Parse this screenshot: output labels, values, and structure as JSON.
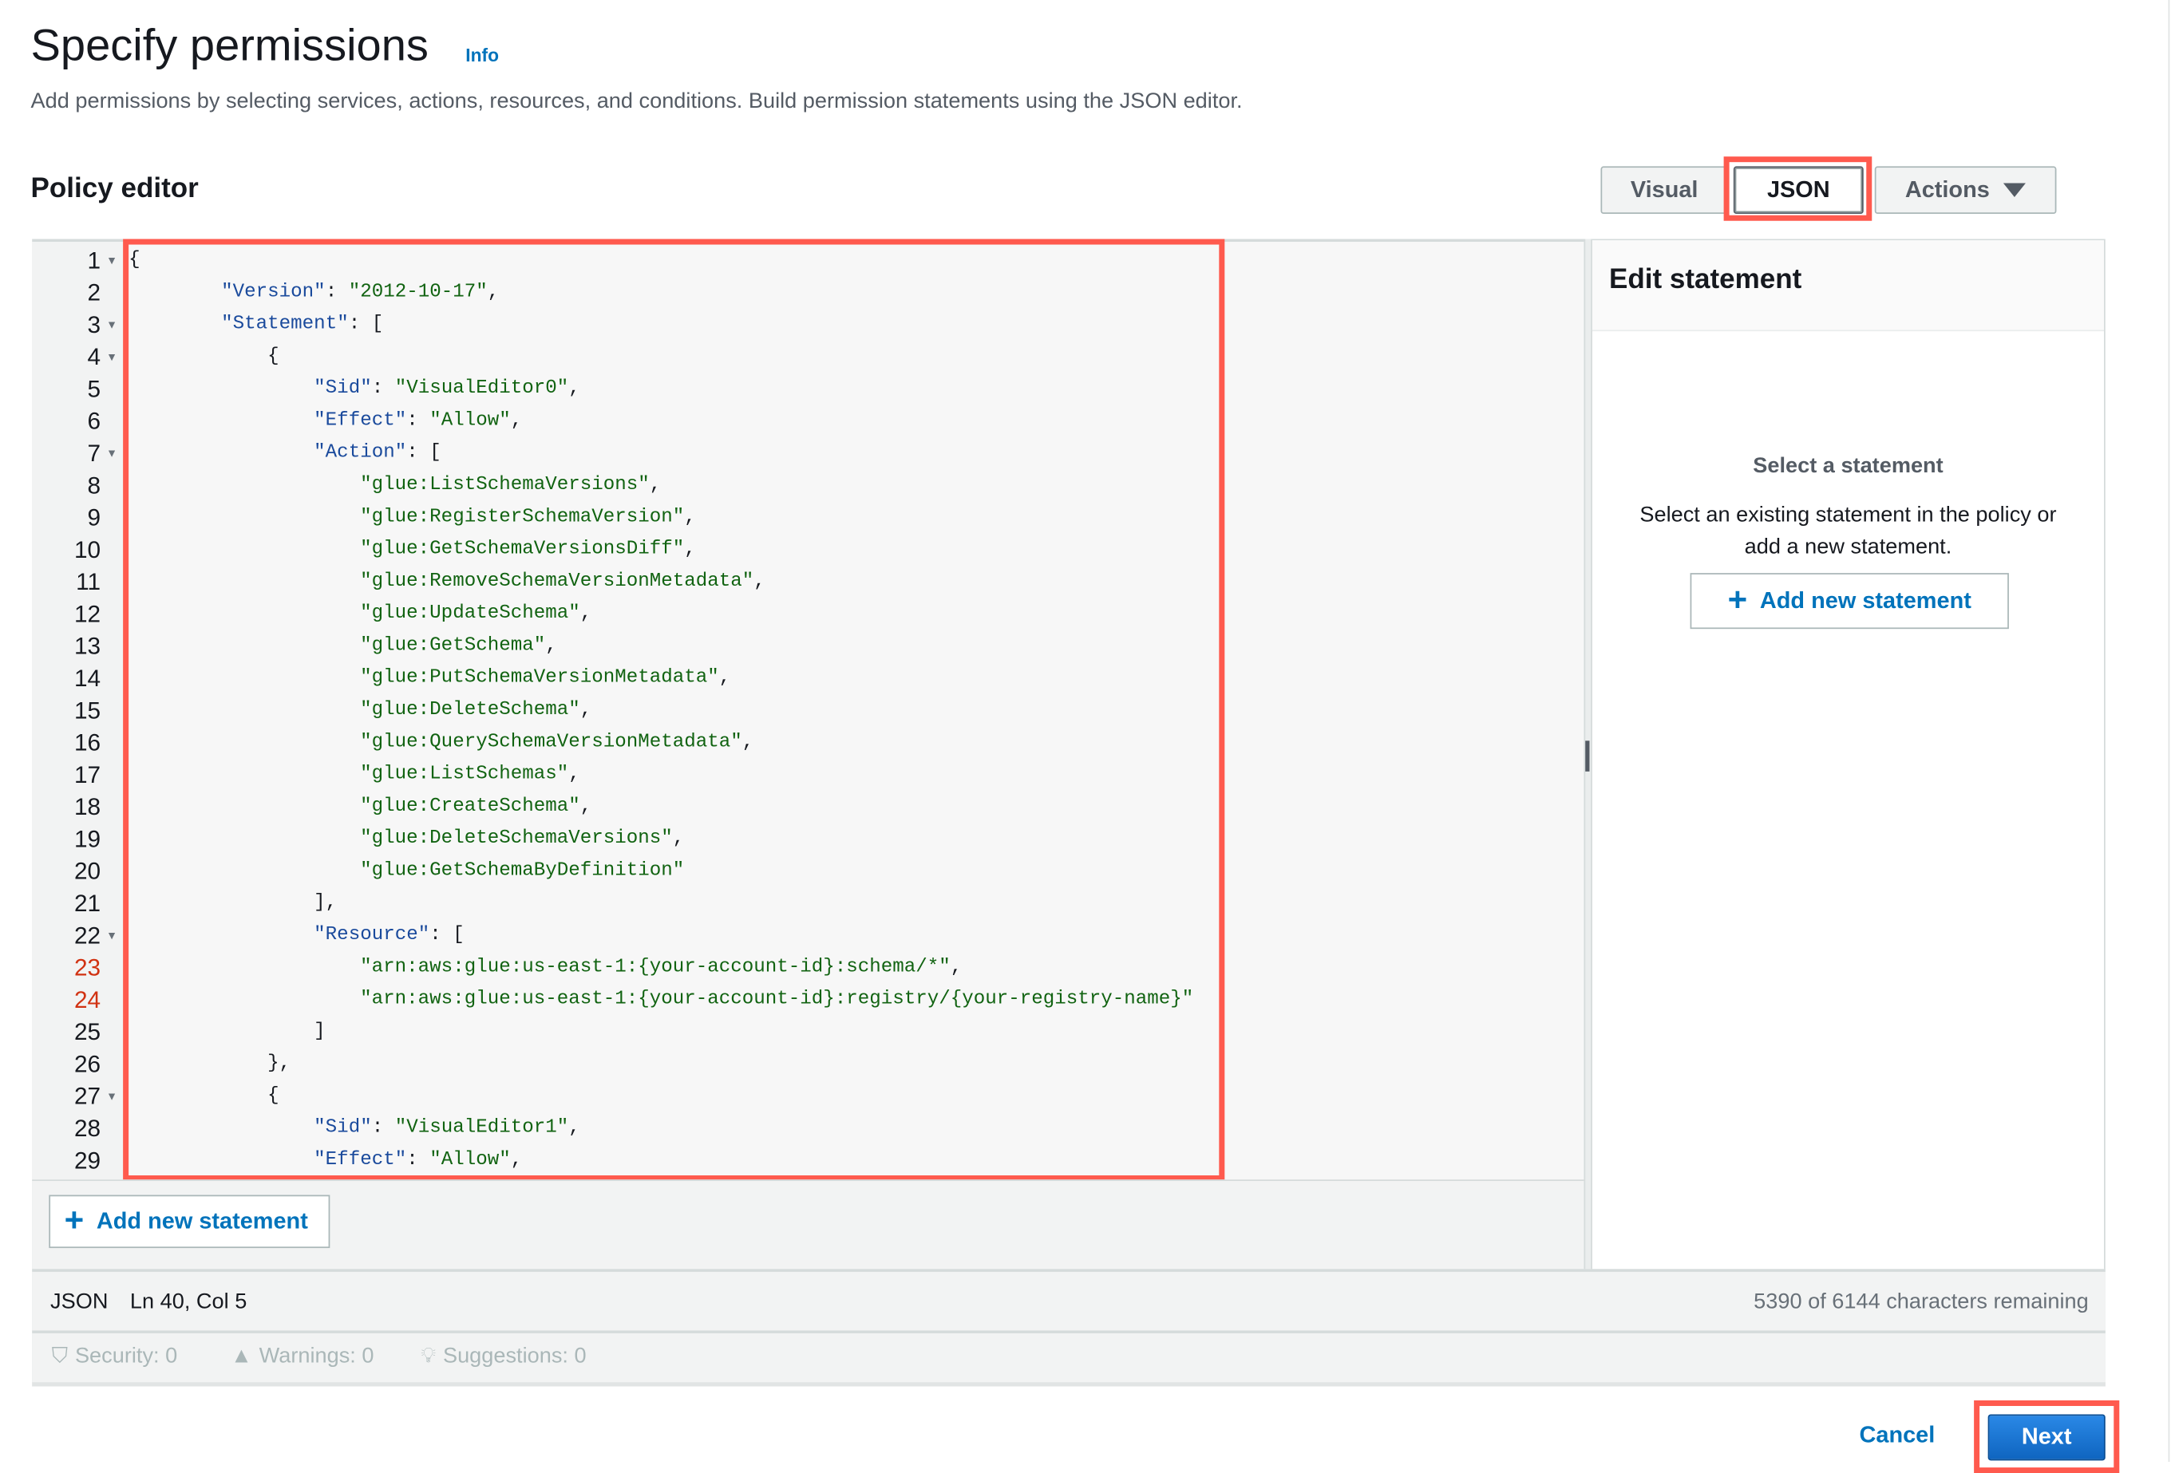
{
  "header": {
    "title": "Specify permissions",
    "info_link": "Info",
    "description": "Add permissions by selecting services, actions, resources, and conditions. Build permission statements using the JSON editor."
  },
  "policy_editor": {
    "title": "Policy editor",
    "tabs": [
      {
        "label": "Visual",
        "active": false
      },
      {
        "label": "JSON",
        "active": true
      }
    ],
    "actions_label": "Actions",
    "code_lines": [
      {
        "n": "1",
        "text": "{",
        "fold": true
      },
      {
        "n": "2",
        "text": "        \"Version\": \"2012-10-17\","
      },
      {
        "n": "3",
        "text": "        \"Statement\": [",
        "fold": true
      },
      {
        "n": "4",
        "text": "            {",
        "fold": true
      },
      {
        "n": "5",
        "text": "                \"Sid\": \"VisualEditor0\","
      },
      {
        "n": "6",
        "text": "                \"Effect\": \"Allow\","
      },
      {
        "n": "7",
        "text": "                \"Action\": [",
        "fold": true
      },
      {
        "n": "8",
        "text": "                    \"glue:ListSchemaVersions\","
      },
      {
        "n": "9",
        "text": "                    \"glue:RegisterSchemaVersion\","
      },
      {
        "n": "10",
        "text": "                    \"glue:GetSchemaVersionsDiff\","
      },
      {
        "n": "11",
        "text": "                    \"glue:RemoveSchemaVersionMetadata\","
      },
      {
        "n": "12",
        "text": "                    \"glue:UpdateSchema\","
      },
      {
        "n": "13",
        "text": "                    \"glue:GetSchema\","
      },
      {
        "n": "14",
        "text": "                    \"glue:PutSchemaVersionMetadata\","
      },
      {
        "n": "15",
        "text": "                    \"glue:DeleteSchema\","
      },
      {
        "n": "16",
        "text": "                    \"glue:QuerySchemaVersionMetadata\","
      },
      {
        "n": "17",
        "text": "                    \"glue:ListSchemas\","
      },
      {
        "n": "18",
        "text": "                    \"glue:CreateSchema\","
      },
      {
        "n": "19",
        "text": "                    \"glue:DeleteSchemaVersions\","
      },
      {
        "n": "20",
        "text": "                    \"glue:GetSchemaByDefinition\""
      },
      {
        "n": "21",
        "text": "                ],"
      },
      {
        "n": "22",
        "text": "                \"Resource\": [",
        "fold": true
      },
      {
        "n": "23",
        "text": "                    \"arn:aws:glue:us-east-1:{your-account-id}:schema/*\",",
        "error": true
      },
      {
        "n": "24",
        "text": "                    \"arn:aws:glue:us-east-1:{your-account-id}:registry/{your-registry-name}\"",
        "error": true
      },
      {
        "n": "25",
        "text": "                ]"
      },
      {
        "n": "26",
        "text": "            },"
      },
      {
        "n": "27",
        "text": "            {",
        "fold": true
      },
      {
        "n": "28",
        "text": "                \"Sid\": \"VisualEditor1\","
      },
      {
        "n": "29",
        "text": "                \"Effect\": \"Allow\","
      }
    ],
    "add_statement_label": "Add new statement",
    "status": {
      "mode": "JSON",
      "cursor": "Ln 40, Col 5",
      "remaining": "5390 of 6144 characters remaining"
    },
    "checks": {
      "security": "Security: 0",
      "warnings": "Warnings: 0",
      "suggestions": "Suggestions: 0"
    }
  },
  "edit_statement": {
    "title": "Edit statement",
    "empty_title": "Select a statement",
    "empty_line1": "Select an existing statement in the policy or",
    "empty_line2": "add a new statement.",
    "add_label": "Add new statement"
  },
  "footer": {
    "cancel_label": "Cancel",
    "next_label": "Next"
  },
  "colors": {
    "accent": "#0073bb",
    "primary_button": "#0d6fcf",
    "highlight": "#ff5a4e",
    "error_line": "#d13212",
    "json_key": "#1a4a9c",
    "json_string": "#116311"
  }
}
